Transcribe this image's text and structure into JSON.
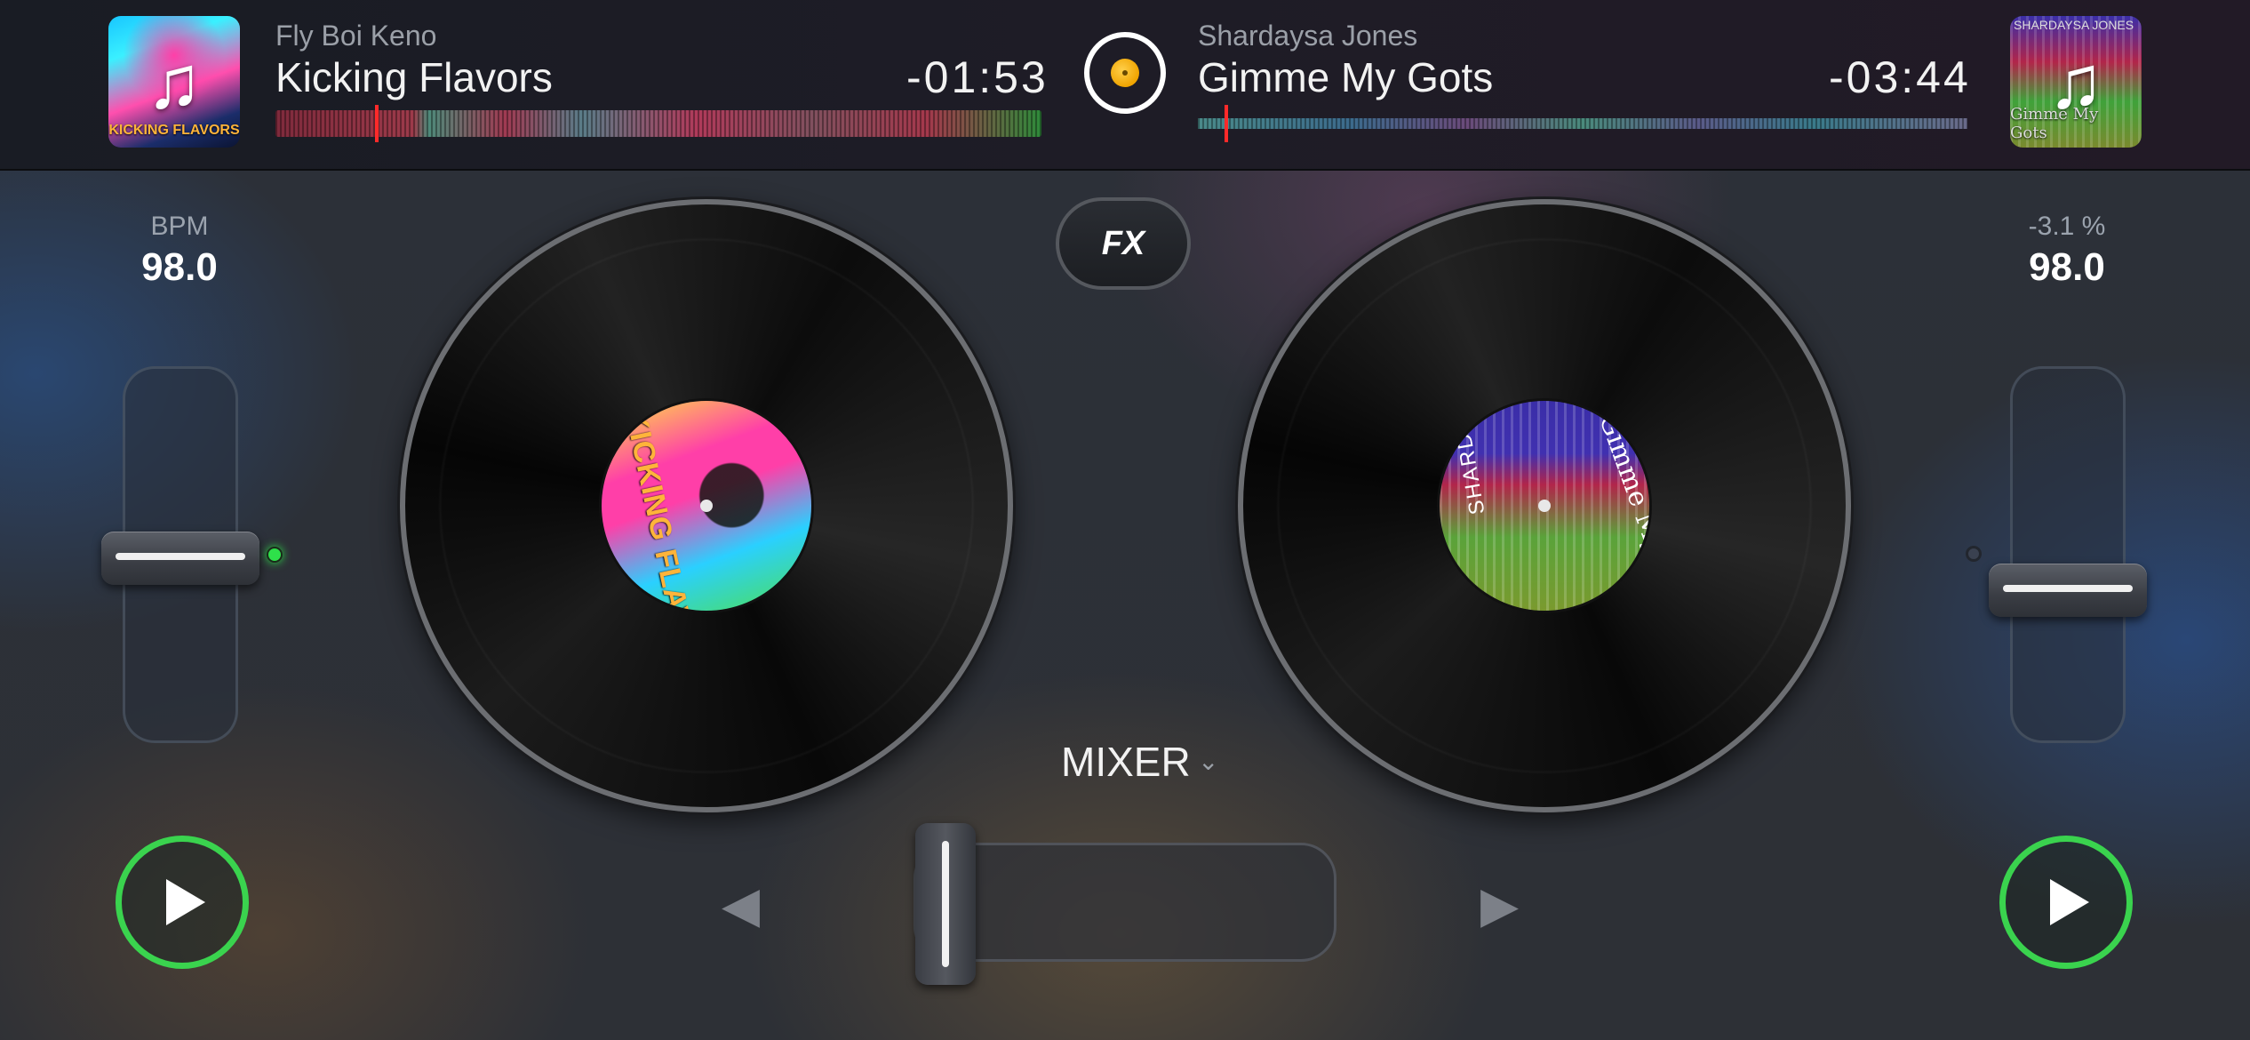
{
  "deck_left": {
    "artist": "Fly Boi Keno",
    "title": "Kicking Flavors",
    "time_remaining": "-01:53",
    "art_caption": "KICKING FLAVORS",
    "label_text": "KICKING FLAVORS",
    "readout_label": "BPM",
    "readout_value": "98.0",
    "playhead_fraction": 0.13,
    "pitch_fraction": 0.51
  },
  "deck_right": {
    "artist": "Shardaysa Jones",
    "title": "Gimme My Gots",
    "time_remaining": "-03:44",
    "art_caption_top": "SHARDAYSA JONES",
    "art_caption": "Gimme My Gots",
    "label_text": "Gimme My Gots",
    "label_text2": "SHARDAYSA JONES",
    "readout_label": "-3.1 %",
    "readout_value": "98.0",
    "playhead_fraction": 0.035,
    "pitch_fraction": 0.61
  },
  "center": {
    "fx_label": "FX",
    "mixer_label": "MIXER",
    "crossfader_position": 0.0
  },
  "colors": {
    "play_ring": "#3ad34e",
    "playhead": "#ff2a2a",
    "sync": "#f0a400"
  },
  "icons": {
    "art_icon": "music-note-icon",
    "play": "play-icon",
    "sync": "sync-icon",
    "left_arrow": "arrow-left-icon",
    "right_arrow": "arrow-right-icon",
    "chevron": "chevron-down-icon"
  }
}
